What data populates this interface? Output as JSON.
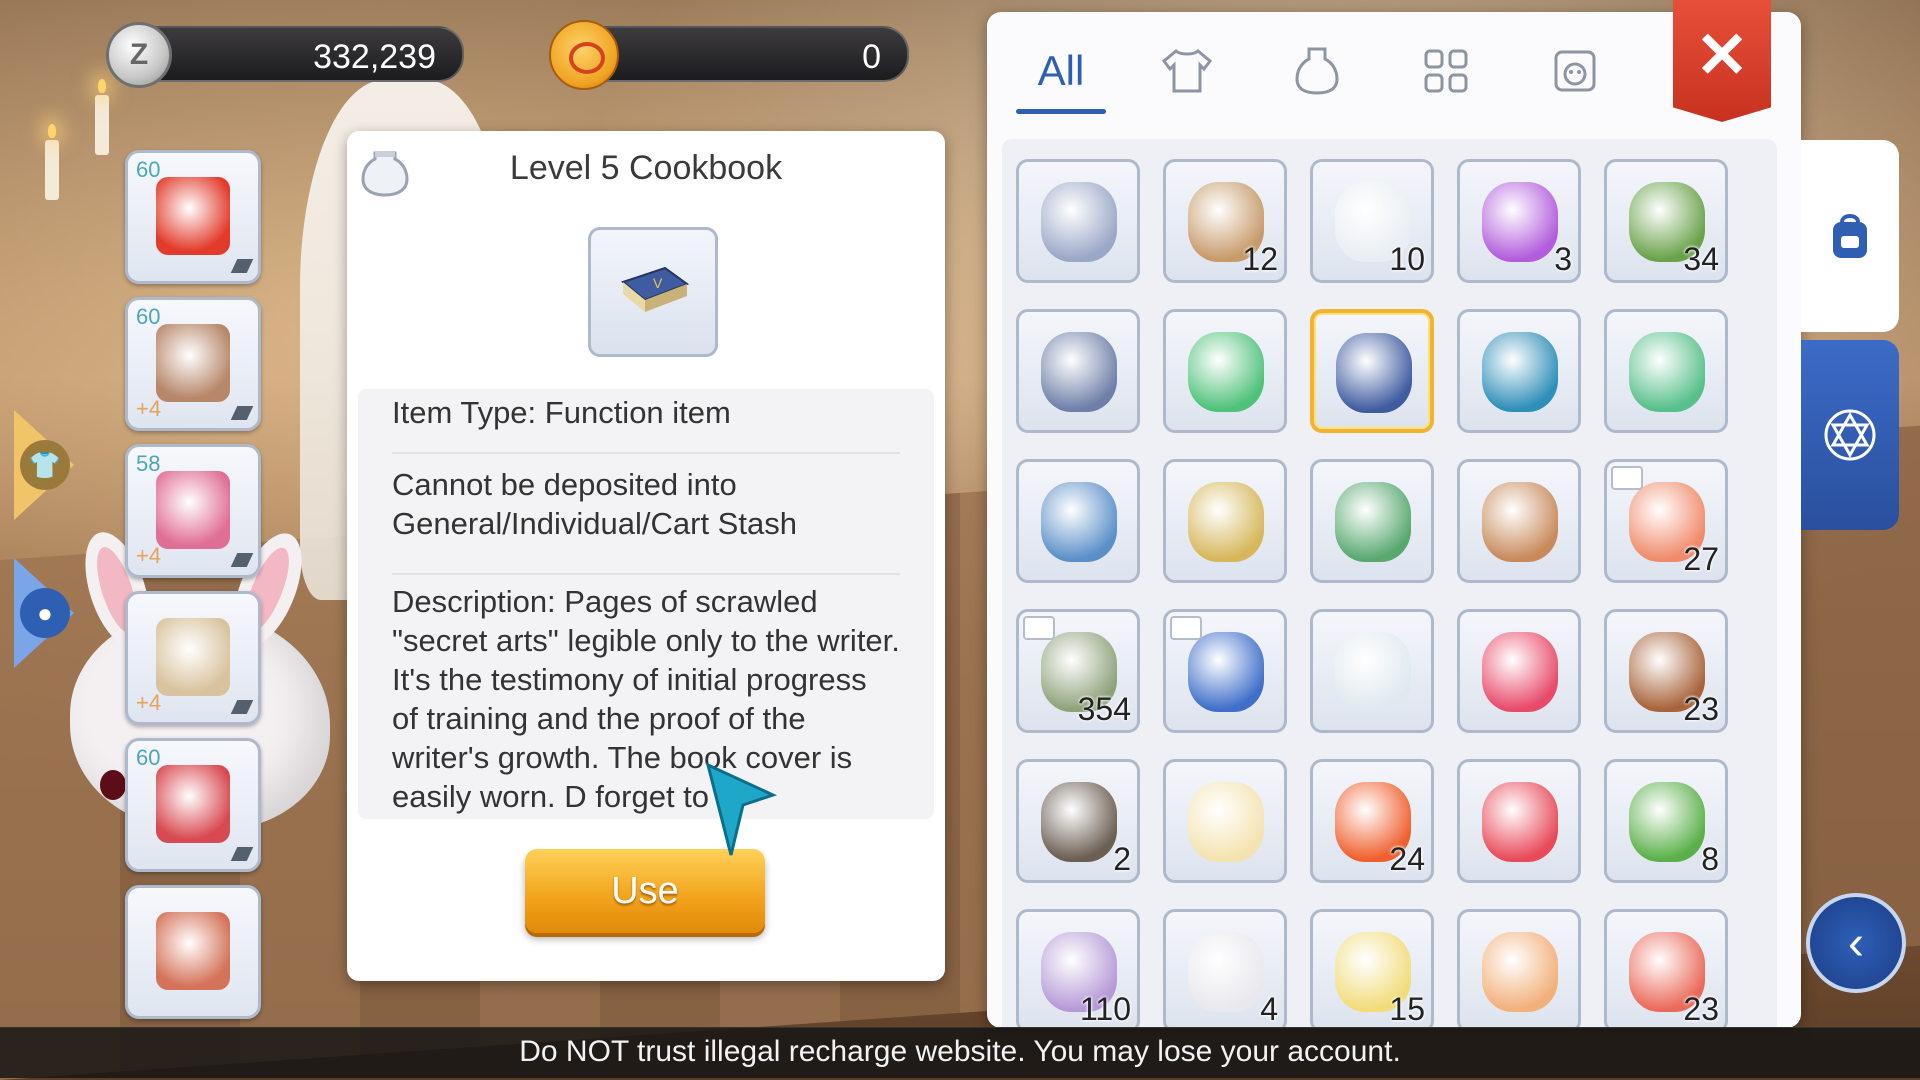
{
  "currency": {
    "zeny_value": "332,239",
    "zeny_icon_letter": "Z",
    "secondary_value": "0"
  },
  "equipment": [
    {
      "level": "60",
      "refine": "",
      "item": "crown",
      "color": "#e23b2b"
    },
    {
      "level": "60",
      "refine": "+4",
      "item": "armor",
      "color": "#b8876a"
    },
    {
      "level": "58",
      "refine": "+4",
      "item": "cape",
      "color": "#e06f96"
    },
    {
      "level": "",
      "refine": "+4",
      "item": "boots",
      "color": "#d9c39e"
    },
    {
      "level": "60",
      "refine": "",
      "item": "accessory",
      "color": "#d84a52"
    },
    {
      "level": "",
      "refine": "",
      "item": "ring",
      "color": "#d4735a"
    }
  ],
  "item_detail": {
    "title": "Level 5 Cookbook",
    "item_type": "Item Type: Function item",
    "deposit_note": "Cannot be deposited into General/Individual/Cart Stash",
    "description": "Description: Pages of scrawled \"secret arts\" legible only to the writer. It's the testimony of initial progress of training and the proof of the writer's growth. The book cover is easily worn. D     forget to",
    "use_label": "Use"
  },
  "inventory": {
    "tabs": [
      {
        "label": "All",
        "icon": "all",
        "active": true
      },
      {
        "label": "",
        "icon": "shirt-icon",
        "active": false
      },
      {
        "label": "",
        "icon": "potion-icon",
        "active": false
      },
      {
        "label": "",
        "icon": "grid-icon",
        "active": false
      },
      {
        "label": "",
        "icon": "pet-icon",
        "active": false
      }
    ],
    "close_label": "✕",
    "items": [
      {
        "name": "chest",
        "qty": "",
        "color": "#9aa7c7"
      },
      {
        "name": "butterfly-wing",
        "qty": "12",
        "color": "#c79a6a"
      },
      {
        "name": "fly-wing",
        "qty": "10",
        "color": "#e8eef3"
      },
      {
        "name": "purple-butterfly",
        "qty": "3",
        "color": "#b25ddc"
      },
      {
        "name": "leaf",
        "qty": "34",
        "color": "#6aa24a"
      },
      {
        "name": "sword-token",
        "qty": "",
        "color": "#6f7fa8"
      },
      {
        "name": "green-backpack",
        "qty": "",
        "color": "#4fc27a"
      },
      {
        "name": "cookbook",
        "qty": "",
        "color": "#3f5ca0",
        "selected": true
      },
      {
        "name": "magnifier",
        "qty": "",
        "color": "#2e8fb8"
      },
      {
        "name": "card-album",
        "qty": "",
        "color": "#58c08b"
      },
      {
        "name": "open-book",
        "qty": "",
        "color": "#5b8fc9"
      },
      {
        "name": "golden-statue",
        "qty": "",
        "color": "#d6b75a"
      },
      {
        "name": "mystery-box",
        "qty": "",
        "color": "#58a870"
      },
      {
        "name": "leather-bag",
        "qty": "",
        "color": "#c88a5c"
      },
      {
        "name": "shell",
        "qty": "27",
        "color": "#f08a6a",
        "tag": true
      },
      {
        "name": "sandwich",
        "qty": "354",
        "color": "#8ea27a",
        "tag": true
      },
      {
        "name": "shield-emblem",
        "qty": "",
        "color": "#3f6fc9",
        "tag": true
      },
      {
        "name": "white-wings",
        "qty": "",
        "color": "#dfe9ef"
      },
      {
        "name": "red-potion-flask",
        "qty": "",
        "color": "#e84a6a"
      },
      {
        "name": "meat-dish",
        "qty": "23",
        "color": "#a8633a"
      },
      {
        "name": "cake-slice",
        "qty": "2",
        "color": "#6b5e52"
      },
      {
        "name": "gem",
        "qty": "",
        "color": "#f4e3b0"
      },
      {
        "name": "apple-juice",
        "qty": "24",
        "color": "#f0602e"
      },
      {
        "name": "candy",
        "qty": "",
        "color": "#e84a5a"
      },
      {
        "name": "green-bottle",
        "qty": "8",
        "color": "#5bb04a"
      },
      {
        "name": "purple-potion",
        "qty": "110",
        "color": "#b69ad8"
      },
      {
        "name": "white-potion",
        "qty": "4",
        "color": "#e8e8ee"
      },
      {
        "name": "yellow-potion",
        "qty": "15",
        "color": "#f2dc7a"
      },
      {
        "name": "orange-potion",
        "qty": "",
        "color": "#f2b07a"
      },
      {
        "name": "red-potion",
        "qty": "23",
        "color": "#ea6a5a"
      }
    ]
  },
  "side_tabs": [
    {
      "icon": "backpack-icon"
    },
    {
      "icon": "star-of-david-icon"
    }
  ],
  "back_label": "‹",
  "warning_text": "Do NOT trust illegal recharge website. You may lose your account.",
  "colors": {
    "accent_blue": "#2e5fb3",
    "use_button": "#f1a21a",
    "close_red": "#d33a26",
    "selected_border": "#f0b431"
  }
}
